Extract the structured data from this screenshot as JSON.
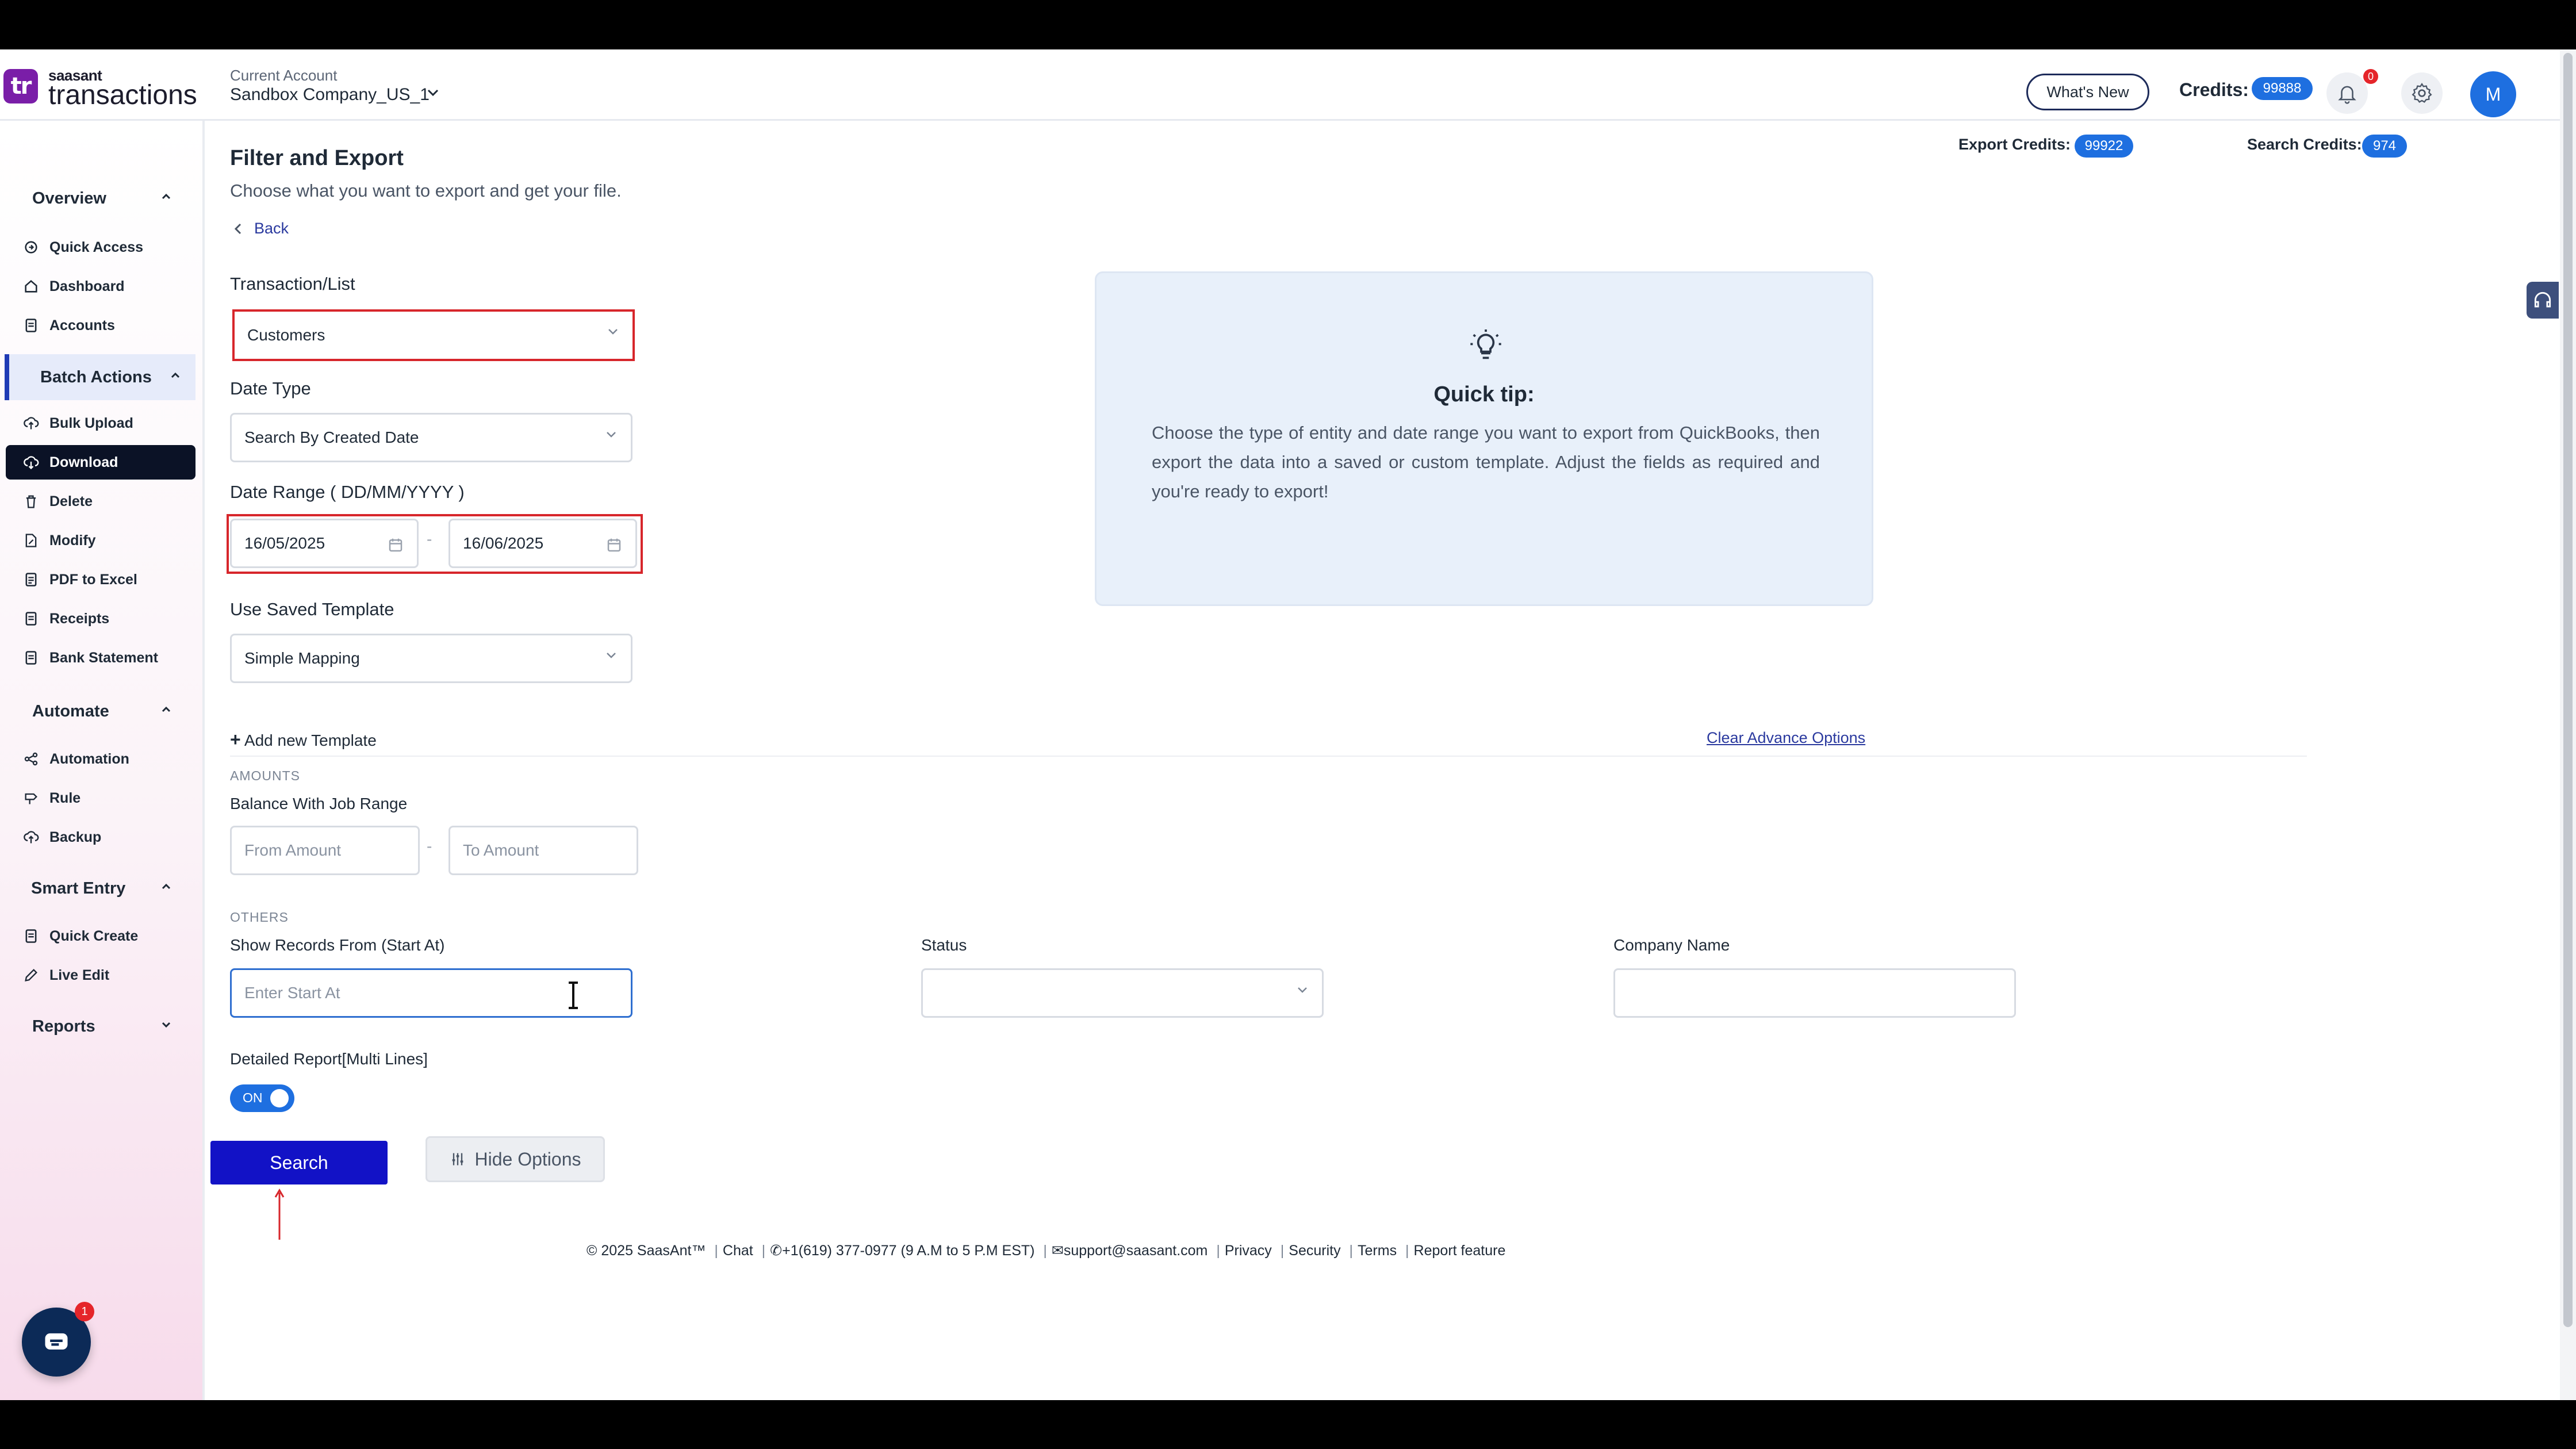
{
  "header": {
    "brand_small": "saasant",
    "brand_large": "transactions",
    "logo_text": "tr",
    "account_label": "Current Account",
    "account_name": "Sandbox Company_US_1",
    "whats_new": "What's New",
    "credits_label": "Credits:",
    "credits_value": "99888",
    "notifications_count": "0",
    "avatar_initial": "M"
  },
  "sidebar": {
    "overview": "Overview",
    "quick_access": "Quick Access",
    "dashboard": "Dashboard",
    "accounts": "Accounts",
    "batch_actions": "Batch Actions",
    "bulk_upload": "Bulk Upload",
    "download": "Download",
    "delete": "Delete",
    "modify": "Modify",
    "pdf_to_excel": "PDF to Excel",
    "receipts": "Receipts",
    "bank_statement": "Bank Statement",
    "automate": "Automate",
    "automation": "Automation",
    "rule": "Rule",
    "backup": "Backup",
    "smart_entry": "Smart Entry",
    "quick_create": "Quick Create",
    "live_edit": "Live Edit",
    "reports": "Reports",
    "chat_badge": "1"
  },
  "main": {
    "title": "Filter and Export",
    "subtitle": "Choose what you want to export and get your file.",
    "back": "Back",
    "export_credits_label": "Export Credits:",
    "export_credits_value": "99922",
    "search_credits_label": "Search Credits:",
    "search_credits_value": "974",
    "transaction_label": "Transaction/List",
    "transaction_value": "Customers",
    "date_type_label": "Date Type",
    "date_type_value": "Search By Created Date",
    "date_range_label": "Date Range ( DD/MM/YYYY )",
    "date_from": "16/05/2025",
    "date_to": "16/06/2025",
    "date_separator": "-",
    "template_label": "Use Saved Template",
    "template_value": "Simple Mapping",
    "add_template": "Add new Template",
    "clear_advance": "Clear Advance Options",
    "tip_title": "Quick tip:",
    "tip_text": "Choose the type of entity and date range you want to export from QuickBooks, then export the data into a saved or custom template. Adjust the fields as required and you're ready to export!",
    "amounts_section": "AMOUNTS",
    "balance_label": "Balance With Job Range",
    "from_amount_placeholder": "From Amount",
    "to_amount_placeholder": "To Amount",
    "others_section": "OTHERS",
    "start_at_label": "Show Records From (Start At)",
    "start_at_placeholder": "Enter Start At",
    "status_label": "Status",
    "status_value": "",
    "company_label": "Company Name",
    "company_value": "",
    "detailed_label": "Detailed Report[Multi Lines]",
    "toggle_state": "ON",
    "search_button": "Search",
    "hide_options_button": "Hide Options"
  },
  "footer": {
    "copyright": "© 2025 SaasAnt™",
    "chat": "Chat",
    "phone": "+1(619) 377-0977 (9 A.M to 5 P.M EST)",
    "email": "support@saasant.com",
    "privacy": "Privacy",
    "security": "Security",
    "terms": "Terms",
    "report_feature": "Report feature"
  },
  "colors": {
    "accent": "#1e6fe0",
    "primary_button": "#1212c6",
    "highlight_border": "#d7262b",
    "active_nav": "#0b1226"
  }
}
